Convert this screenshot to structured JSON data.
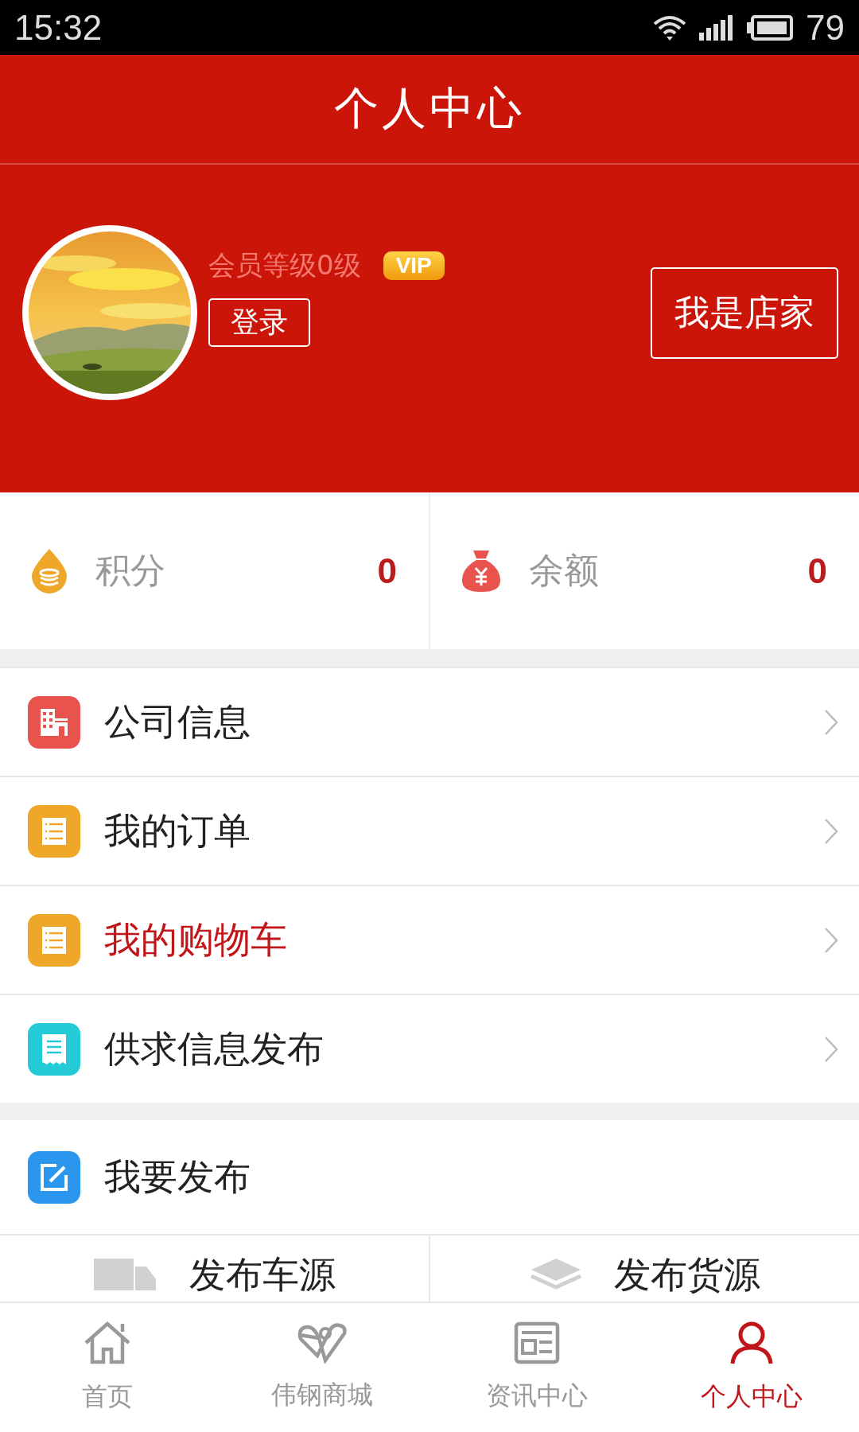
{
  "status_bar": {
    "time": "15:32",
    "battery": "79"
  },
  "header": {
    "title": "个人中心"
  },
  "profile": {
    "level": "会员等级0级",
    "badge": "VIP",
    "login_button": "登录",
    "shop_button": "我是店家"
  },
  "stats": [
    {
      "kind": "points",
      "label": "积分",
      "value": "0"
    },
    {
      "kind": "balance",
      "label": "余额",
      "value": "0"
    }
  ],
  "menu": [
    {
      "label": "公司信息",
      "highlighted": false
    },
    {
      "label": "我的订单",
      "highlighted": false
    },
    {
      "label": "我的购物车",
      "highlighted": true
    },
    {
      "label": "供求信息发布",
      "highlighted": false
    }
  ],
  "publish": {
    "title": "我要发布",
    "options": [
      {
        "label": "发布车源"
      },
      {
        "label": "发布货源"
      }
    ]
  },
  "tabs": [
    {
      "label": "首页",
      "selected": false
    },
    {
      "label": "伟钢商城",
      "selected": false
    },
    {
      "label": "资讯中心",
      "selected": false
    },
    {
      "label": "个人中心",
      "selected": true
    }
  ]
}
